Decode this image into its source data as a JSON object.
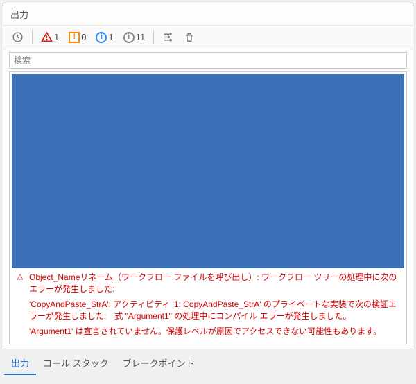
{
  "panel": {
    "title": "出力"
  },
  "toolbar": {
    "error_count": "1",
    "warn_count": "0",
    "info_count": "1",
    "detail_count": "11"
  },
  "search": {
    "placeholder": "検索"
  },
  "messages": [
    {
      "icon": "△",
      "text": "Object_Nameリネーム（ワークフロー ファイルを呼び出し）: ワークフロー ツリーの処理中に次のエラーが発生しました:"
    },
    {
      "icon": "",
      "text": "'CopyAndPaste_StrA': アクティビティ '1: CopyAndPaste_StrA' のプライベートな実装で次の検証エラーが発生しました:　式 \"Argument1\" の処理中にコンパイル エラーが発生しました。"
    },
    {
      "icon": "",
      "text": "'Argument1' は宣言されていません。保護レベルが原因でアクセスできない可能性もあります。"
    }
  ],
  "tabs": {
    "output": "出力",
    "callstack": "コール スタック",
    "breakpoints": "ブレークポイント"
  }
}
